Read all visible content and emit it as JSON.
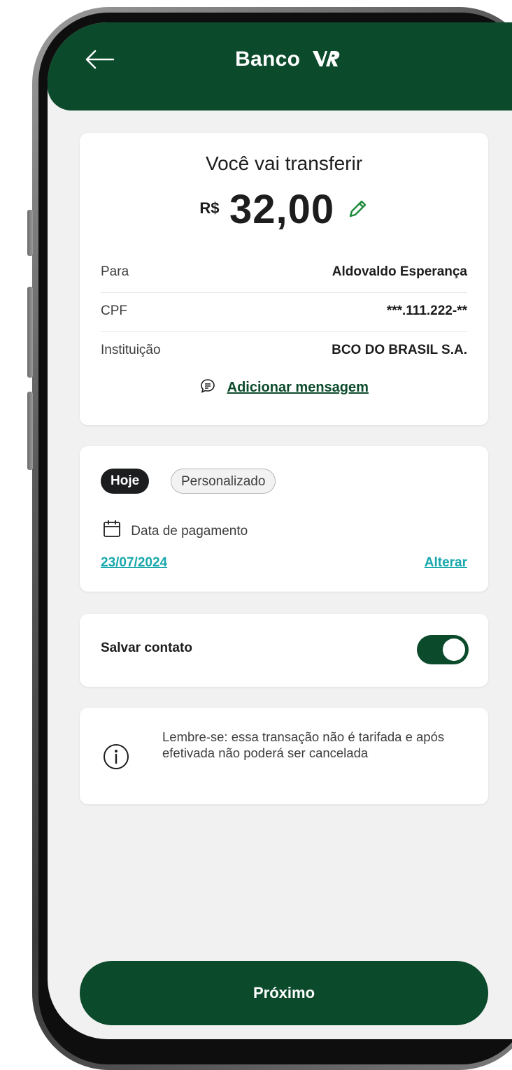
{
  "header": {
    "back_icon": "arrow-left-icon",
    "brand_name": "Banco",
    "brand_logo": "vr-logo",
    "bg_color": "#0b4a2b"
  },
  "summary": {
    "title": "Você vai transferir",
    "currency": "R$",
    "amount": "32,00",
    "edit_icon": "pencil-icon",
    "rows": [
      {
        "label": "Para",
        "value": "Aldovaldo Esperança"
      },
      {
        "label": "CPF",
        "value": "***.111.222-**"
      },
      {
        "label": "Instituição",
        "value": "BCO DO BRASIL S.A."
      }
    ],
    "message_icon": "chat-bubble-icon",
    "message_link": "Adicionar mensagem"
  },
  "schedule": {
    "chips": [
      {
        "label": "Hoje",
        "selected": true
      },
      {
        "label": "Personalizado",
        "selected": false
      }
    ],
    "calendar_icon": "calendar-icon",
    "date_label": "Data de pagamento",
    "date_value": "23/07/2024",
    "change_link": "Alterar",
    "link_color": "#17a8ad"
  },
  "save_contact": {
    "label": "Salvar contato",
    "enabled": true
  },
  "notice": {
    "icon": "info-icon",
    "text": "Lembre-se: essa transação não é tarifada e após efetivada não poderá ser cancelada"
  },
  "footer": {
    "next_label": "Próximo"
  }
}
